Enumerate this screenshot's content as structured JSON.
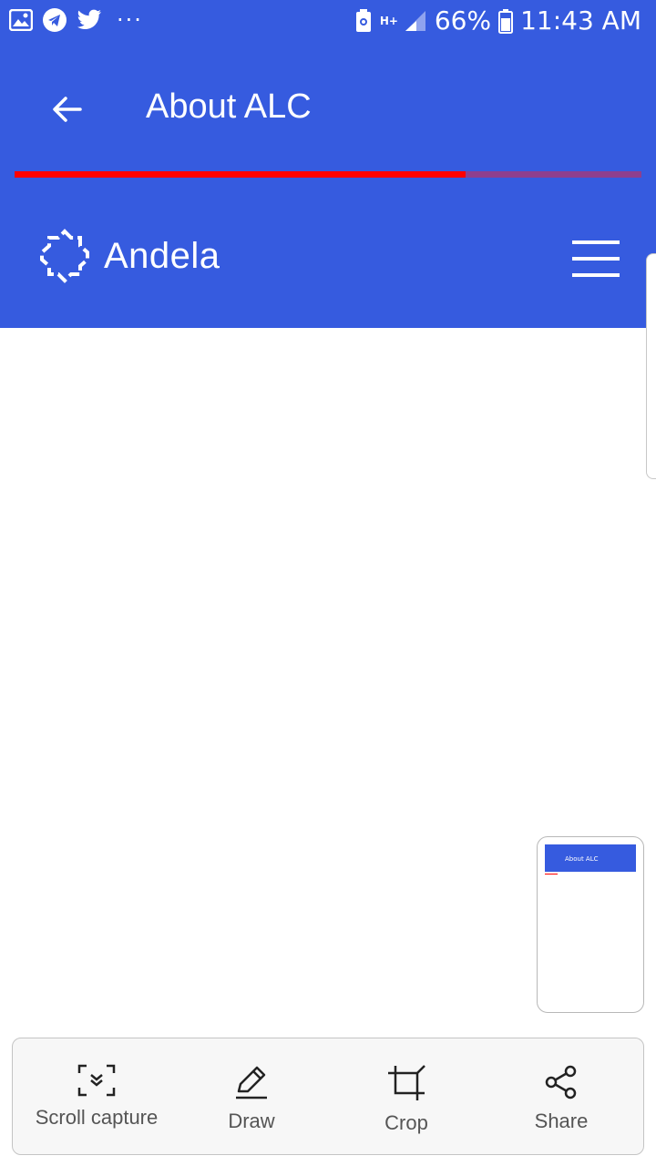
{
  "status_bar": {
    "notification_icons": [
      "gallery-icon",
      "telegram-icon",
      "twitter-icon",
      "more-dots-icon"
    ],
    "more_glyph": "···",
    "network_label": "H+",
    "battery_percent": "66%",
    "time": "11:43 AM"
  },
  "app_bar": {
    "title": "About ALC",
    "load_progress": 0.72
  },
  "site_header": {
    "brand_name": "Andela",
    "menu_icon": "hamburger-menu-icon"
  },
  "screenshot_preview": {
    "title": "About ALC"
  },
  "screenshot_toolbar": {
    "items": [
      {
        "label": "Scroll capture",
        "icon": "scroll-capture-icon"
      },
      {
        "label": "Draw",
        "icon": "pencil-icon"
      },
      {
        "label": "Crop",
        "icon": "crop-icon"
      },
      {
        "label": "Share",
        "icon": "share-icon"
      }
    ]
  },
  "colors": {
    "brand_blue": "#365bdf",
    "progress_red": "#ff0000",
    "white": "#ffffff"
  }
}
